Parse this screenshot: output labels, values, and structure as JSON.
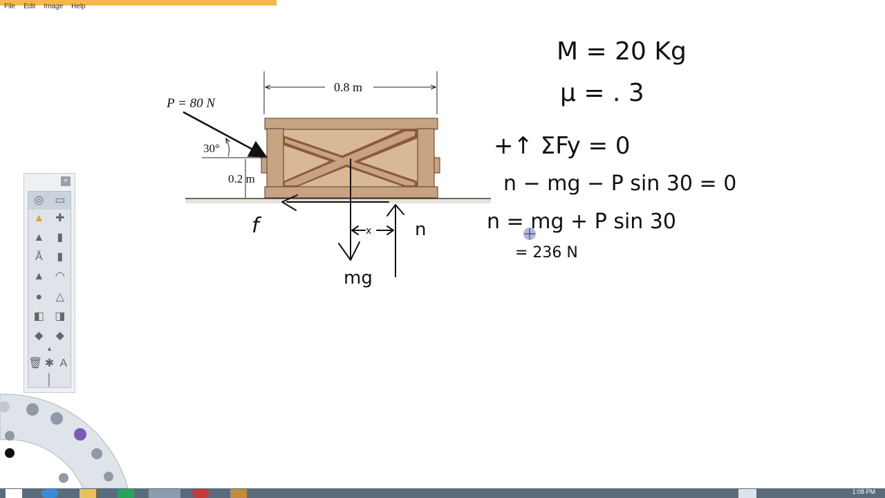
{
  "menu": {
    "file": "File",
    "edit": "Edit",
    "image": "Image",
    "help": "Help"
  },
  "diagram": {
    "force_label": "P = 80 N",
    "width_label": "0.8 m",
    "angle_label": "30°",
    "height_label": "0.2 m"
  },
  "handwriting": {
    "mass": "M = 20 Kg",
    "mu": "μ = . 3",
    "sum_fy": "+↑ ΣFy = 0",
    "eq1": "n − mg − P sin 30 = 0",
    "eq2": "n = mg + P sin 30",
    "eq3": "= 236 N",
    "f": "f",
    "n": "n",
    "mg": "mg",
    "x": "x"
  },
  "palette": {
    "close": "×"
  },
  "clock": "1:08 PM",
  "colors": {
    "ink": "#111111",
    "crate": "#b98a66",
    "crate_dark": "#6e4a30",
    "taskbar": "#5a6b7c"
  }
}
